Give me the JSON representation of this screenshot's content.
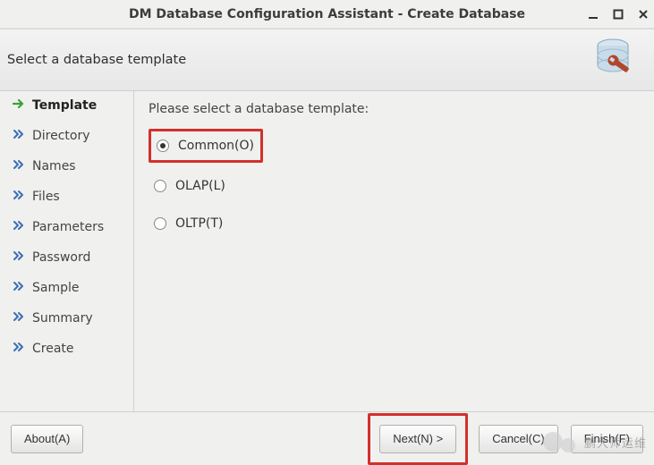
{
  "window": {
    "title": "DM Database Configuration Assistant - Create Database"
  },
  "header": {
    "title": "Select a database template"
  },
  "sidebar": {
    "steps": [
      {
        "label": "Template",
        "active": true
      },
      {
        "label": "Directory",
        "active": false
      },
      {
        "label": "Names",
        "active": false
      },
      {
        "label": "Files",
        "active": false
      },
      {
        "label": "Parameters",
        "active": false
      },
      {
        "label": "Password",
        "active": false
      },
      {
        "label": "Sample",
        "active": false
      },
      {
        "label": "Summary",
        "active": false
      },
      {
        "label": "Create",
        "active": false
      }
    ]
  },
  "content": {
    "prompt": "Please select a database template:",
    "options": [
      {
        "label": "Common(O)",
        "selected": true,
        "highlighted": true
      },
      {
        "label": "OLAP(L)",
        "selected": false,
        "highlighted": false
      },
      {
        "label": "OLTP(T)",
        "selected": false,
        "highlighted": false
      }
    ]
  },
  "footer": {
    "about": "About(A)",
    "next": "Next(N) >",
    "cancel": "Cancel(C)",
    "finish": "Finish(F)"
  },
  "watermark": {
    "text": "鹏大师运维"
  },
  "colors": {
    "highlight": "#d3302b"
  }
}
